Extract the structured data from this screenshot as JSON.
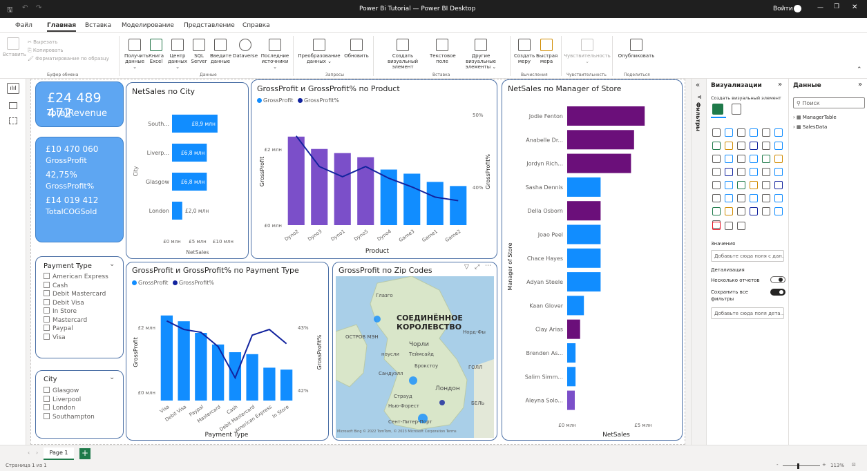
{
  "window": {
    "title": "Power Bi Tutorial — Power BI Desktop",
    "signin": "Войти"
  },
  "menu": [
    "Файл",
    "Главная",
    "Вставка",
    "Моделирование",
    "Представление",
    "Справка"
  ],
  "ribbon": {
    "paste": "Вставить",
    "cut": "Вырезать",
    "copy": "Копировать",
    "format_painter": "Форматирование по образцу",
    "group_clipboard": "Буфер обмена",
    "get_data": "Получить данные ⌄",
    "excel": "Книга Excel",
    "hub": "Центр данных ⌄",
    "sql": "SQL Server",
    "enter_data": "Введите данные",
    "dataverse": "Dataverse",
    "recent": "Последние источники ⌄",
    "group_data": "Данные",
    "transform": "Преобразование данных ⌄",
    "refresh": "Обновить",
    "group_queries": "Запросы",
    "new_visual": "Создать визуальный элемент",
    "text_box": "Текстовое поле",
    "more_visuals": "Другие визуальные элементы ⌄",
    "group_insert": "Вставка",
    "new_measure": "Создать меру",
    "quick_measure": "Быстрая мера",
    "group_calc": "Вычисления",
    "sensitivity": "Чувствительность ⌄",
    "group_sens": "Чувствительность",
    "publish": "Опубликовать",
    "group_share": "Поделиться"
  },
  "kpi1": {
    "value": "£24 489 472",
    "label": "TotalRevenue"
  },
  "kpi2": {
    "v1": "£10 470 060",
    "l1": "GrossProfit",
    "v2": "42,75%",
    "l2": "GrossProfit%",
    "v3": "£14 019 412",
    "l3": "TotalCOGSold"
  },
  "chart_data": [
    {
      "type": "bar",
      "title": "NetSales по City",
      "categories": [
        "South...",
        "Liverp...",
        "Glasgow",
        "London"
      ],
      "values": [
        8.9,
        6.8,
        6.8,
        2.0
      ],
      "data_labels": [
        "£8,9 млн",
        "£6,8 млн",
        "£6,8 млн",
        "£2,0 млн"
      ],
      "xlabel": "NetSales",
      "ylabel": "City",
      "xticks": [
        "£0 млн",
        "£5 млн",
        "£10 млн"
      ],
      "color": "#118dff"
    },
    {
      "type": "bar",
      "title": "GrossProfit и GrossProfit% по Product",
      "series": [
        {
          "name": "GrossProfit",
          "values": [
            2.15,
            1.85,
            1.75,
            1.65,
            1.35,
            1.25,
            1.05,
            0.95
          ]
        },
        {
          "name": "GrossProfit%",
          "values": [
            51.5,
            45.5,
            43.5,
            45.5,
            43.2,
            41.5,
            39.5,
            38.8
          ]
        }
      ],
      "categories": [
        "Dyno2",
        "Dyno3",
        "Dyno1",
        "Dyno5",
        "Dyno4",
        "Game3",
        "Game1",
        "Game2"
      ],
      "bar_colors": [
        "#7b4fc9",
        "#7b4fc9",
        "#7b4fc9",
        "#7b4fc9",
        "#118dff",
        "#118dff",
        "#118dff",
        "#118dff"
      ],
      "xlabel": "Product",
      "ylabel": "GrossProfit",
      "y2label": "GrossProfit%",
      "yticks": [
        "£0 млн",
        "£2 млн"
      ],
      "y2ticks": [
        "40%",
        "50%"
      ]
    },
    {
      "type": "bar",
      "title": "GrossProfit и GrossProfit% по Payment Type",
      "series": [
        {
          "name": "GrossProfit",
          "values": [
            2.2,
            2.05,
            1.75,
            1.45,
            1.25,
            1.2,
            0.85,
            0.8
          ]
        },
        {
          "name": "GrossProfit%",
          "values": [
            43.0,
            42.85,
            42.8,
            42.55,
            42.0,
            42.75,
            42.85,
            42.6
          ]
        }
      ],
      "categories": [
        "Visa",
        "Debit Visa",
        "Paypal",
        "Mastercard",
        "Cash",
        "Debit Mastercard",
        "American Express",
        "In Store"
      ],
      "xlabel": "Payment Type",
      "ylabel": "GrossProfit",
      "y2label": "GrossProfit%",
      "yticks": [
        "£0 млн",
        "£2 млн"
      ],
      "y2ticks": [
        "42%",
        "43%"
      ]
    },
    {
      "type": "bar",
      "title": "NetSales по Manager of Store",
      "categories": [
        "Jodie Fenton",
        "Anabelle Dr...",
        "Jordyn Rich...",
        "Sasha Dennis",
        "Della Osborn",
        "Joao Peel",
        "Chace Hayes",
        "Adyan Steele",
        "Kaan Glover",
        "Clay Arias",
        "Brenden As...",
        "Salim Simm...",
        "Aleyna Solo..."
      ],
      "values": [
        5.1,
        4.4,
        4.2,
        2.2,
        2.2,
        2.2,
        2.2,
        2.2,
        1.1,
        0.85,
        0.55,
        0.55,
        0.5
      ],
      "bar_colors": [
        "#6b0f7a",
        "#6b0f7a",
        "#6b0f7a",
        "#118dff",
        "#6b0f7a",
        "#118dff",
        "#118dff",
        "#118dff",
        "#118dff",
        "#6b0f7a",
        "#118dff",
        "#118dff",
        "#7b4fc9"
      ],
      "xlabel": "NetSales",
      "ylabel": "Manager of Store",
      "xticks": [
        "£0 млн",
        "£5 млн"
      ]
    }
  ],
  "slicer_payment": {
    "title": "Payment Type",
    "items": [
      "American Express",
      "Cash",
      "Debit Mastercard",
      "Debit Visa",
      "In Store",
      "Mastercard",
      "Paypal",
      "Visa"
    ]
  },
  "slicer_city": {
    "title": "City",
    "items": [
      "Glasgow",
      "Liverpool",
      "London",
      "Southampton"
    ]
  },
  "map": {
    "title": "GrossProfit по Zip Codes",
    "country": "СОЕДИНЁННОЕ КОРОЛЕВСТВО",
    "labels": [
      "Глазго",
      "ОСТРОВ МЭН",
      "Норд-Фы",
      "Чорли",
      "ноусли",
      "Теймсайд",
      "Брокстоу",
      "ГОЛЛ",
      "Сандуэлл",
      "Лондон",
      "Страуд",
      "Нью-Форест",
      "БЕЛЬ",
      "Сент-Питер-Порт"
    ],
    "credit": "© 2022 TomTom, © 2023 Microsoft Corporation  Terms",
    "ms": "Microsoft Bing"
  },
  "filters": "Фильтры",
  "viz": {
    "title": "Визуализации",
    "create": "Создать визуальный элемент",
    "values": "Значения",
    "values_well": "Добавьте сюда поля с дан...",
    "drill": "Детализация",
    "cross_report": "Несколько отчетов",
    "keep_filters": "Сохранить все фильтры",
    "drill_well": "Добавьте сюда поля дета..."
  },
  "data": {
    "title": "Данные",
    "search": "Поиск",
    "tables": [
      "ManagerTable",
      "SalesData"
    ]
  },
  "pages": {
    "page1": "Page 1"
  },
  "status": {
    "page": "Страница 1 из 1",
    "zoom": "113%"
  }
}
